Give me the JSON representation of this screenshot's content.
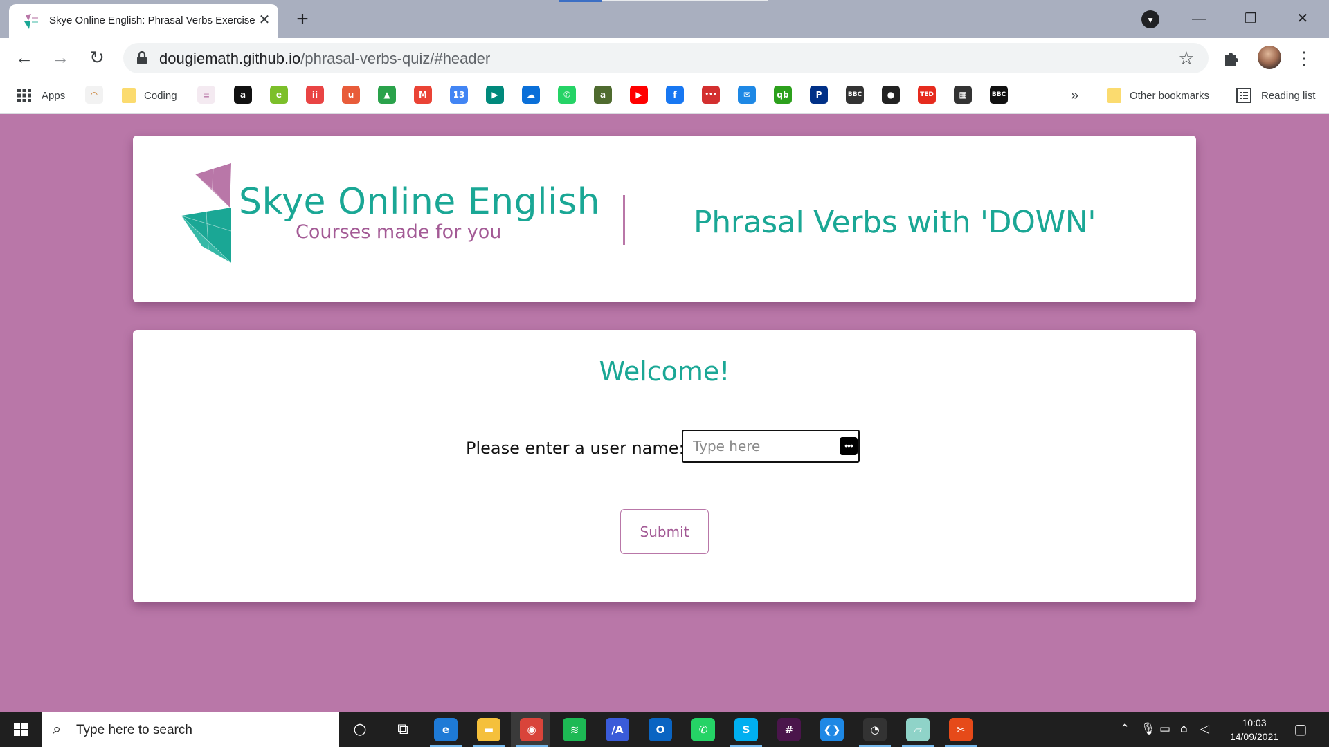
{
  "browser": {
    "tab": {
      "title": "Skye Online English: Phrasal Verbs Exercise"
    },
    "address": {
      "domain": "dougiemath.github.io",
      "path": "/phrasal-verbs-quiz/#header"
    },
    "bookmarks": {
      "apps_label": "Apps",
      "coding_label": "Coding",
      "other_label": "Other bookmarks",
      "reading_list_label": "Reading list",
      "overflow": "»",
      "icons": [
        {
          "name": "amazon-icon",
          "glyph": "a",
          "color": "#111111"
        },
        {
          "name": "green-e-icon",
          "glyph": "e",
          "color": "#7cbf2a"
        },
        {
          "name": "quiz-icon",
          "glyph": "ii",
          "color": "#e94444"
        },
        {
          "name": "u-icon",
          "glyph": "u",
          "color": "#e85c3a"
        },
        {
          "name": "drive-icon",
          "glyph": "▲",
          "color": "#2aa24b"
        },
        {
          "name": "gmail-icon",
          "glyph": "M",
          "color": "#ea4335"
        },
        {
          "name": "calendar-icon",
          "glyph": "13",
          "color": "#4285f4"
        },
        {
          "name": "meet-icon",
          "glyph": "▶",
          "color": "#00897b"
        },
        {
          "name": "onedrive-icon",
          "glyph": "☁",
          "color": "#0a6fd8"
        },
        {
          "name": "whatsapp-icon",
          "glyph": "✆",
          "color": "#25d366"
        },
        {
          "name": "a-icon",
          "glyph": "a",
          "color": "#4f6b2f"
        },
        {
          "name": "youtube-icon",
          "glyph": "▶",
          "color": "#ff0000"
        },
        {
          "name": "facebook-icon",
          "glyph": "f",
          "color": "#1877f2"
        },
        {
          "name": "dots-icon",
          "glyph": "•••",
          "color": "#d32f2f"
        },
        {
          "name": "mail-icon",
          "glyph": "✉",
          "color": "#1e88e5"
        },
        {
          "name": "quickbooks-icon",
          "glyph": "qb",
          "color": "#2ca01c"
        },
        {
          "name": "paypal-icon",
          "glyph": "P",
          "color": "#003087"
        },
        {
          "name": "bbc-small-icon",
          "glyph": "BBC",
          "color": "#333333"
        },
        {
          "name": "globe-icon",
          "glyph": "●",
          "color": "#222222"
        },
        {
          "name": "ted-icon",
          "glyph": "TED",
          "color": "#e62b1e"
        },
        {
          "name": "grid-icon",
          "glyph": "▦",
          "color": "#333333"
        },
        {
          "name": "bbc-icon",
          "glyph": "BBC",
          "color": "#111111"
        }
      ]
    }
  },
  "page": {
    "logo": {
      "title": "Skye Online English",
      "tagline": "Courses made for you"
    },
    "quiz_title": "Phrasal Verbs with 'DOWN'",
    "welcome": "Welcome!",
    "username_label": "Please enter a user name:",
    "username_placeholder": "Type here",
    "submit_label": "Submit",
    "colors": {
      "background": "#b977a8",
      "teal": "#1aa795",
      "purple": "#a35a95"
    }
  },
  "taskbar": {
    "search_placeholder": "Type here to search",
    "time": "10:03",
    "date": "14/09/2021",
    "apps": [
      {
        "name": "cortana-icon",
        "glyph": "○",
        "color": "transparent"
      },
      {
        "name": "task-view-icon",
        "glyph": "⧉",
        "color": "transparent"
      },
      {
        "name": "edge-icon",
        "glyph": "e",
        "color": "#1e7ad6"
      },
      {
        "name": "file-explorer-icon",
        "glyph": "▬",
        "color": "#f5c03b"
      },
      {
        "name": "chrome-icon",
        "glyph": "◉",
        "color": "#d9443a"
      },
      {
        "name": "spotify-icon",
        "glyph": "≋",
        "color": "#1db954"
      },
      {
        "name": "pen-app-icon",
        "glyph": "/A",
        "color": "#3a5bd9"
      },
      {
        "name": "outlook-icon",
        "glyph": "O",
        "color": "#0a64c2"
      },
      {
        "name": "whatsapp-desktop-icon",
        "glyph": "✆",
        "color": "#25d366"
      },
      {
        "name": "skype-icon",
        "glyph": "S",
        "color": "#00aff0"
      },
      {
        "name": "slack-icon",
        "glyph": "#",
        "color": "#4a154b"
      },
      {
        "name": "vscode-icon",
        "glyph": "❮❯",
        "color": "#1e88e5"
      },
      {
        "name": "obs-icon",
        "glyph": "◔",
        "color": "#333333"
      },
      {
        "name": "notes-app-icon",
        "glyph": "▱",
        "color": "#8fd3c8"
      },
      {
        "name": "snip-tool-icon",
        "glyph": "✂",
        "color": "#e64a19"
      }
    ]
  }
}
